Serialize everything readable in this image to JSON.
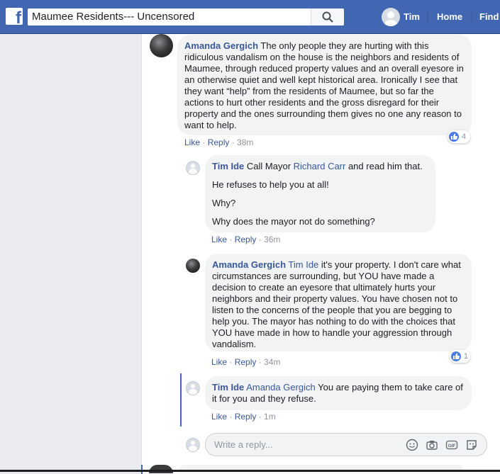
{
  "topbar": {
    "logo": "f",
    "search_value": "Maumee Residents--- Uncensored",
    "user_name": "Tim",
    "home_label": "Home",
    "find_label": "Find"
  },
  "comments": [
    {
      "author": "Amanda Gergich",
      "text": "The only people they are hurting with this ridiculous vandalism on the house is the neighbors and residents of Maumee, through reduced property values and an overall eyesore in an otherwise quiet and well kept historical area. Ironically I see that they want “help” from the residents of Maumee, but so far the actions to hurt other residents and the gross disregard for their property and the ones surrounding them gives no one any reason to want to help.",
      "like": "Like",
      "reply": "Reply",
      "time": "38m",
      "reactions": "4"
    },
    {
      "author": "Tim Ide",
      "text_before": "Call Mayor ",
      "mention": "Richard Carr",
      "text_after": " and read him that.",
      "lines": [
        "He refuses to help you at all!",
        "Why?",
        "Why does the mayor not do something?"
      ],
      "like": "Like",
      "reply": "Reply",
      "time": "36m"
    },
    {
      "author": "Amanda Gergich",
      "mention": "Tim Ide",
      "text": " it's your property. I don't care what circumstances are surrounding, but YOU have made a decision to create an eyesore that ultimately hurts your neighbors and their property values. You have chosen not to listen to the concerns of the people that you are begging to help you. The mayor has nothing to do with the choices that YOU have made in how to handle your aggression through vandalism.",
      "like": "Like",
      "reply": "Reply",
      "time": "34m",
      "reactions": "1"
    },
    {
      "author": "Tim Ide",
      "mention": "Amanda Gergich",
      "text": " You are paying them to take care of it for you and they refuse.",
      "like": "Like",
      "reply": "Reply",
      "time": "1m"
    }
  ],
  "reply_box": {
    "placeholder": "Write a reply..."
  },
  "colors": {
    "brand": "#4267b2",
    "link": "#385898",
    "bubble": "#f2f3f5"
  },
  "icons": [
    "search-icon",
    "like-icon",
    "emoji-icon",
    "camera-icon",
    "gif-icon",
    "sticker-icon"
  ]
}
